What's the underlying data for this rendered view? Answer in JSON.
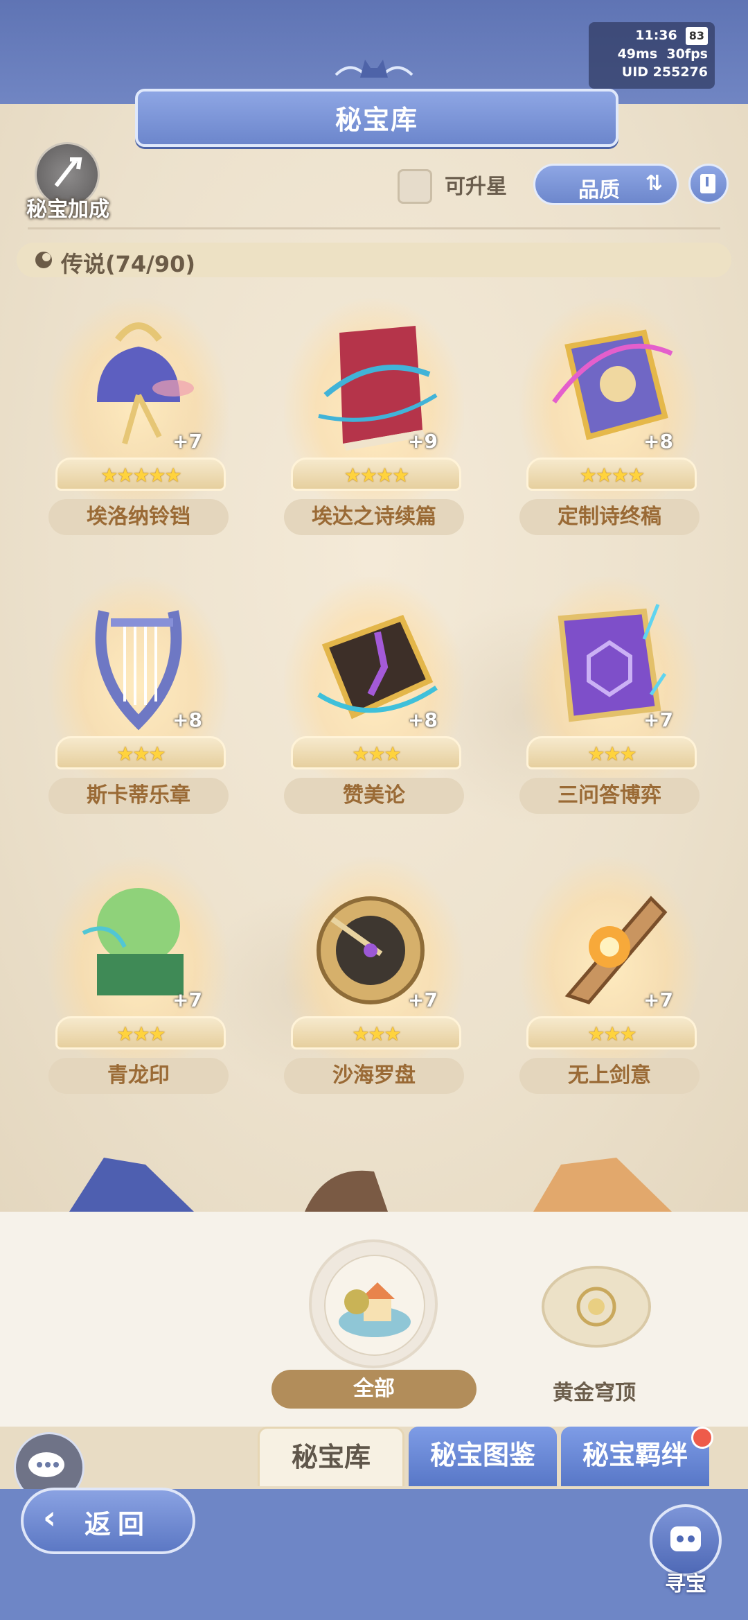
{
  "status": {
    "time": "11:36",
    "battery": "83",
    "ping": "49ms",
    "fps": "30fps",
    "uid": "UID 255276"
  },
  "header": {
    "title": "秘宝库"
  },
  "toolbar": {
    "bonus_label": "秘宝加成",
    "upgradable_label": "可升星",
    "sort_label": "品质"
  },
  "section": {
    "title": "传说(74/90)"
  },
  "items": [
    {
      "name": "埃洛纳铃铛",
      "level": "+7",
      "stars": 5,
      "icon": "bell-icon"
    },
    {
      "name": "埃达之诗续篇",
      "level": "+9",
      "stars": 4,
      "icon": "red-book-icon"
    },
    {
      "name": "定制诗终稿",
      "level": "+8",
      "stars": 4,
      "icon": "purple-book-icon"
    },
    {
      "name": "斯卡蒂乐章",
      "level": "+8",
      "stars": 3,
      "icon": "lyre-icon"
    },
    {
      "name": "赞美论",
      "level": "+8",
      "stars": 3,
      "icon": "gold-tome-icon"
    },
    {
      "name": "三问答博弈",
      "level": "+7",
      "stars": 3,
      "icon": "violet-tome-icon"
    },
    {
      "name": "青龙印",
      "level": "+7",
      "stars": 3,
      "icon": "jade-seal-icon"
    },
    {
      "name": "沙海罗盘",
      "level": "+7",
      "stars": 3,
      "icon": "compass-icon"
    },
    {
      "name": "无上剑意",
      "level": "+7",
      "stars": 3,
      "icon": "sword-shard-icon"
    }
  ],
  "filters": {
    "all_label": "全部",
    "golden_label": "黄金穹顶"
  },
  "tabs": {
    "vault": "秘宝库",
    "codex": "秘宝图鉴",
    "bond": "秘宝羁绊"
  },
  "footer": {
    "back_label": "返回",
    "seek_label": "寻宝"
  },
  "colors": {
    "accent_blue": "#6f86c2",
    "parchment": "#f4ead8",
    "star": "#ffd33d",
    "name_text": "#9a6a35"
  }
}
